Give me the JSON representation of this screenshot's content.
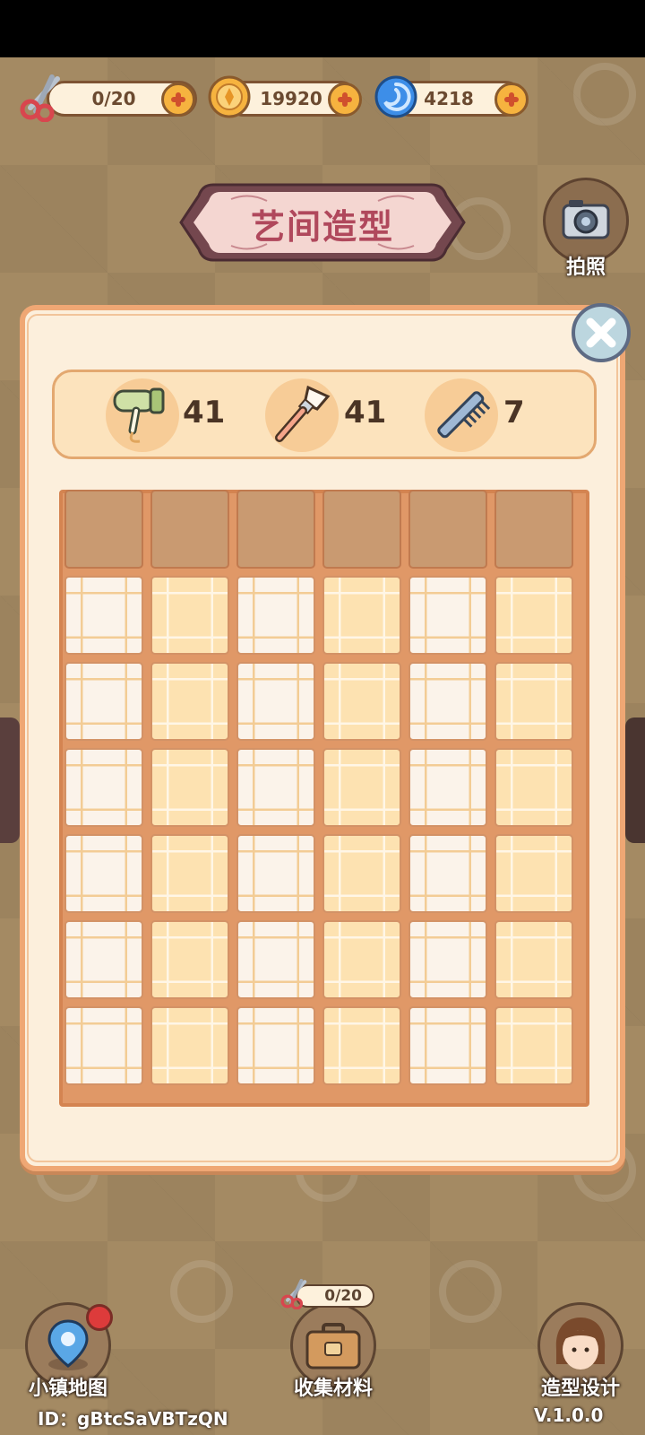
{
  "resources": {
    "scissors": {
      "value": "0/20",
      "icon": "scissors-icon"
    },
    "coins": {
      "value": "19920",
      "icon": "coin-icon"
    },
    "gems": {
      "value": "4218",
      "icon": "blue-swirl-icon"
    }
  },
  "title": "艺间造型",
  "camera": {
    "label": "拍照"
  },
  "tools": [
    {
      "icon": "hair-dryer-icon",
      "count": "41"
    },
    {
      "icon": "makeup-brush-icon",
      "count": "41"
    },
    {
      "icon": "comb-icon",
      "count": "7"
    }
  ],
  "grid": {
    "columns": 6,
    "header_rows": 1,
    "rows": 6
  },
  "nav": {
    "map_label": "小镇地图",
    "collect_label": "收集材料",
    "collect_counter": "0/20",
    "design_label": "造型设计"
  },
  "footer": {
    "id": "ID：gBtcSaVBTzQN",
    "version": "V.1.0.0"
  },
  "colors": {
    "title": "#b0485c",
    "panel": "#fcefdc",
    "accent": "#f6b33f"
  }
}
